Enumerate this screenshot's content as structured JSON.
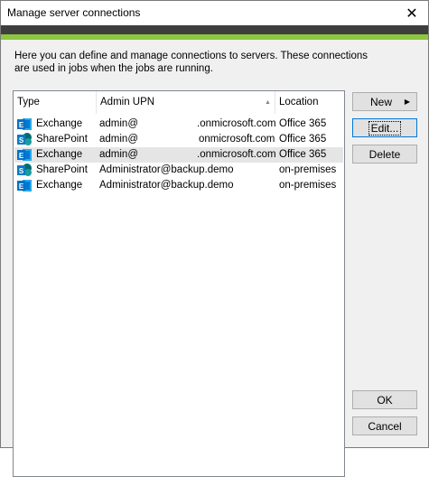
{
  "window": {
    "title": "Manage server connections"
  },
  "description": "Here you can define and manage connections to servers. These connections are used in jobs when the jobs are running.",
  "table": {
    "columns": [
      "Type",
      "Admin UPN",
      "Location"
    ],
    "rows": [
      {
        "type": "Exchange",
        "icon": "exchange-icon",
        "admin_user": "admin@",
        "admin_domain": ".onmicrosoft.com",
        "location": "Office 365"
      },
      {
        "type": "SharePoint",
        "icon": "sharepoint-icon",
        "admin_user": "admin@",
        "admin_domain": "onmicrosoft.com",
        "location": "Office 365"
      },
      {
        "type": "Exchange",
        "icon": "exchange-icon",
        "admin_user": "admin@",
        "admin_domain": ".onmicrosoft.com",
        "location": "Office 365"
      },
      {
        "type": "SharePoint",
        "icon": "sharepoint-icon",
        "admin_user": "Administrator@backup.demo",
        "admin_domain": "",
        "location": "on-premises"
      },
      {
        "type": "Exchange",
        "icon": "exchange-icon",
        "admin_user": "Administrator@backup.demo",
        "admin_domain": "",
        "location": "on-premises"
      }
    ]
  },
  "buttons": {
    "new": "New",
    "edit": "Edit...",
    "delete": "Delete",
    "ok": "OK",
    "cancel": "Cancel"
  },
  "colors": {
    "accent_green": "#8dc63f",
    "band_dark": "#3e3e3e",
    "exchange_blue": "#0072c6",
    "sharepoint_blue": "#0a7bc1"
  }
}
